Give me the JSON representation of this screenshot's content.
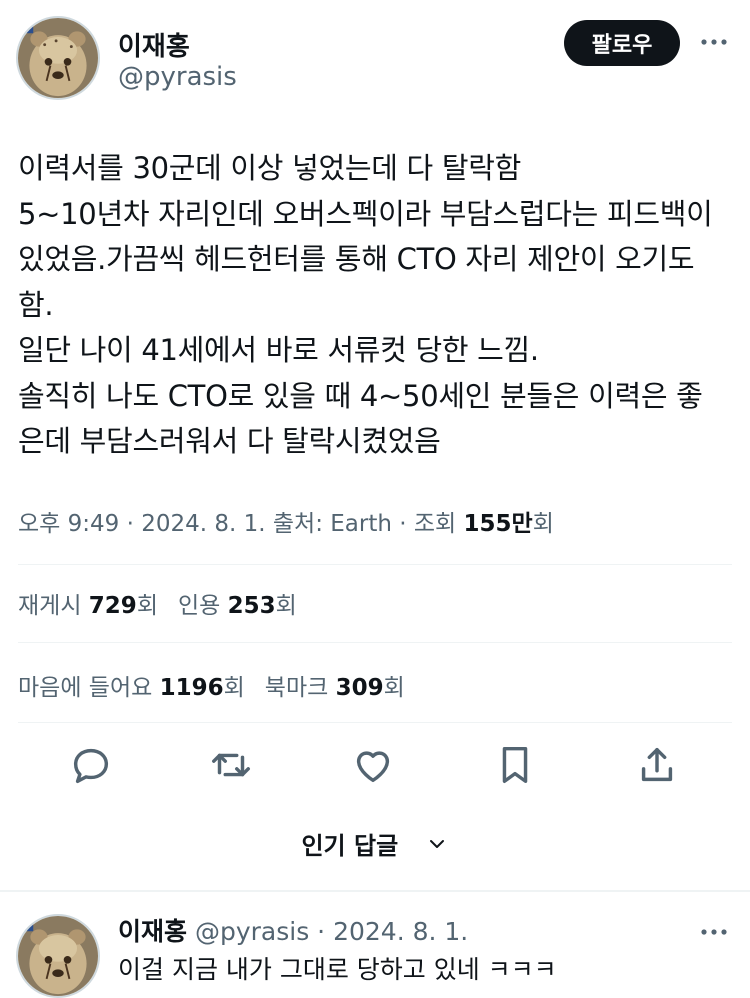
{
  "header": {
    "name": "이재홍",
    "handle": "@pyrasis",
    "follow_label": "팔로우"
  },
  "tweet": {
    "lines": [
      "이력서를 30군데 이상 넣었는데 다 탈락함",
      "5~10년차 자리인데 오버스펙이라 부담스럽다는 피드백이",
      "있었음.가끔씩 헤드헌터를 통해 CTO 자리 제안이 오기도",
      "함.",
      "일단 나이 41세에서 바로 서류컷 당한 느낌.",
      "솔직히 나도 CTO로 있을 때 4~50세인 분들은 이력은 좋",
      "은데 부담스러워서 다 탈락시켰었음"
    ],
    "meta_prefix": "오후 9:49 · 2024. 8. 1. 출처: Earth · 조회 ",
    "views_value": "155만",
    "views_suffix": "회"
  },
  "stats": {
    "retweets_label": "재게시",
    "retweets_value": "729",
    "retweets_suffix": "회",
    "quotes_label": "인용",
    "quotes_value": "253",
    "quotes_suffix": "회",
    "likes_label": "마음에 들어요",
    "likes_value": "1196",
    "likes_suffix": "회",
    "bookmarks_label": "북마크",
    "bookmarks_value": "309",
    "bookmarks_suffix": "회"
  },
  "actions": {
    "icons": [
      "reply-icon",
      "retweet-icon",
      "like-icon",
      "bookmark-icon",
      "share-icon"
    ]
  },
  "sort": {
    "label": "인기 답글"
  },
  "reply": {
    "name": "이재홍",
    "meta": "@pyrasis · 2024. 8. 1.",
    "text": "이걸 지금 내가 그대로 당하고 있네 ㅋㅋㅋ"
  },
  "colors": {
    "text": "#0f1419",
    "secondary": "#536471",
    "divider": "#eff3f4",
    "button_bg": "#0f1419"
  }
}
